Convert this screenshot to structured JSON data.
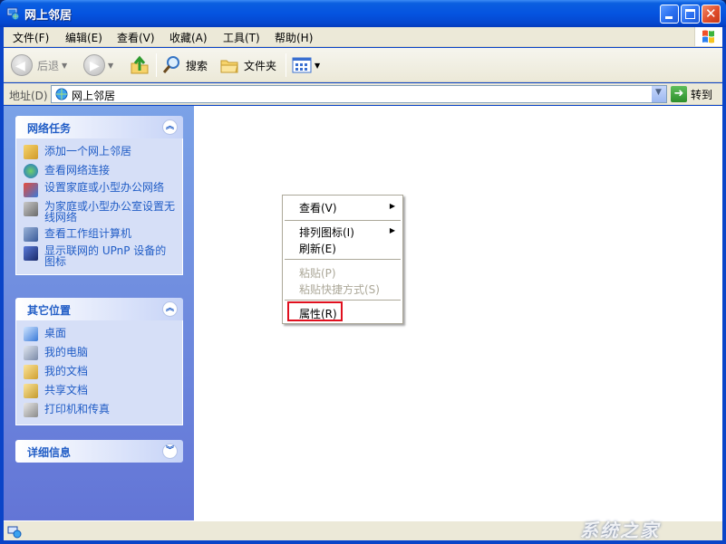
{
  "window": {
    "title": "网上邻居"
  },
  "menubar": {
    "items": [
      {
        "label": "文件(F)"
      },
      {
        "label": "编辑(E)"
      },
      {
        "label": "查看(V)"
      },
      {
        "label": "收藏(A)"
      },
      {
        "label": "工具(T)"
      },
      {
        "label": "帮助(H)"
      }
    ]
  },
  "toolbar": {
    "back_label": "后退",
    "search_label": "搜索",
    "folders_label": "文件夹"
  },
  "addressbar": {
    "label": "地址(D)",
    "value": "网上邻居",
    "go_label": "转到"
  },
  "leftpane": {
    "network_tasks": {
      "title": "网络任务",
      "items": [
        {
          "label": "添加一个网上邻居"
        },
        {
          "label": "查看网络连接"
        },
        {
          "label": "设置家庭或小型办公网络"
        },
        {
          "label": "为家庭或小型办公室设置无线网络"
        },
        {
          "label": "查看工作组计算机"
        },
        {
          "label": "显示联网的 UPnP 设备的图标"
        }
      ]
    },
    "other_places": {
      "title": "其它位置",
      "items": [
        {
          "label": "桌面"
        },
        {
          "label": "我的电脑"
        },
        {
          "label": "我的文档"
        },
        {
          "label": "共享文档"
        },
        {
          "label": "打印机和传真"
        }
      ]
    },
    "details": {
      "title": "详细信息"
    }
  },
  "context_menu": {
    "view": "查看(V)",
    "arrange": "排列图标(I)",
    "refresh": "刷新(E)",
    "paste": "粘贴(P)",
    "paste_shortcut": "粘贴快捷方式(S)",
    "properties": "属性(R)"
  },
  "watermark": {
    "text": "系统之家"
  },
  "colors": {
    "titlebar": "#0554e0",
    "task_link": "#215dc6",
    "highlight_box": "#e0101e"
  }
}
